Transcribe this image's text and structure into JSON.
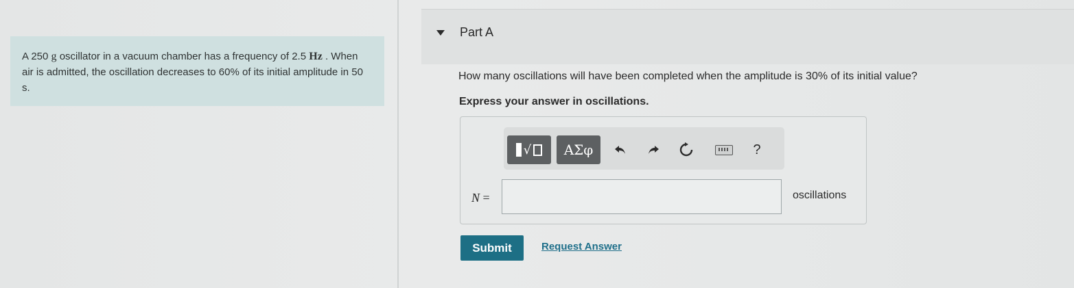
{
  "problem": {
    "text_1": "A 250 ",
    "unit_mass": "g",
    "text_2": " oscillator in a vacuum chamber has a frequency of 2.5",
    "unit_freq": "Hz",
    "text_3": " . When air is admitted, the oscillation decreases to 60% of its initial amplitude in 50 s."
  },
  "part": {
    "title": "Part A",
    "question": "How many oscillations will have been completed when the amplitude is 30% of its initial value?",
    "instruction": "Express your answer in oscillations."
  },
  "toolbar": {
    "template_icon": "templates-icon",
    "greek_label": "ΑΣφ",
    "undo_glyph": "⬅",
    "help_label": "?"
  },
  "answer": {
    "variable": "N",
    "equals": " =",
    "value": "",
    "unit": "oscillations"
  },
  "actions": {
    "submit_label": "Submit",
    "request_label": "Request Answer"
  },
  "colors": {
    "problem_bg": "#cfe0e0",
    "submit_bg": "#1d6f85",
    "link": "#1f6f8a",
    "toolbar_button": "#5d6062"
  }
}
